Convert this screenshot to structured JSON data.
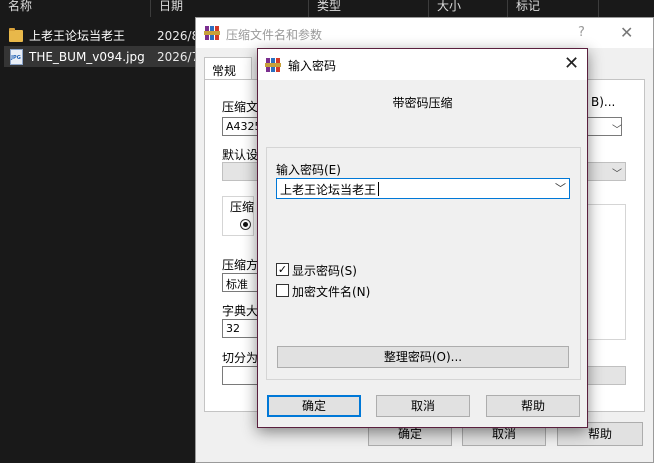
{
  "explorer": {
    "columns": [
      "名称",
      "日期",
      "类型",
      "大小",
      "标记"
    ],
    "files": [
      {
        "name": "上老王论坛当老王",
        "date": "2026/8",
        "icon": "folder-icon"
      },
      {
        "name": "THE_BUM_v094.jpg",
        "date": "2026/7",
        "icon": "jpg-file-icon"
      }
    ]
  },
  "back_dialog": {
    "title": "压缩文件名和参数",
    "help_glyph": "?",
    "close_glyph": "✕",
    "tab_general": "常规",
    "label_archive": "压缩文",
    "archive_value": "A4325",
    "label_default": "默认设",
    "label_compress_group": "压缩",
    "label_method": "压缩方",
    "method_value": "标准",
    "label_dict": "字典大",
    "dict_value": "32",
    "label_split": "切分为",
    "browse_suffix": "B)...",
    "ok": "确定",
    "cancel": "取消",
    "help": "帮助"
  },
  "password_dialog": {
    "title": "输入密码",
    "close_glyph": "✕",
    "subtitle": "带密码压缩",
    "password_label": "输入密码(E)",
    "password_value": "上老王论坛当老王",
    "show_password": {
      "label": "显示密码(S)",
      "checked": true
    },
    "encrypt_filenames": {
      "label": "加密文件名(N)",
      "checked": false
    },
    "organize_button": "整理密码(O)...",
    "ok": "确定",
    "cancel": "取消",
    "help": "帮助"
  }
}
